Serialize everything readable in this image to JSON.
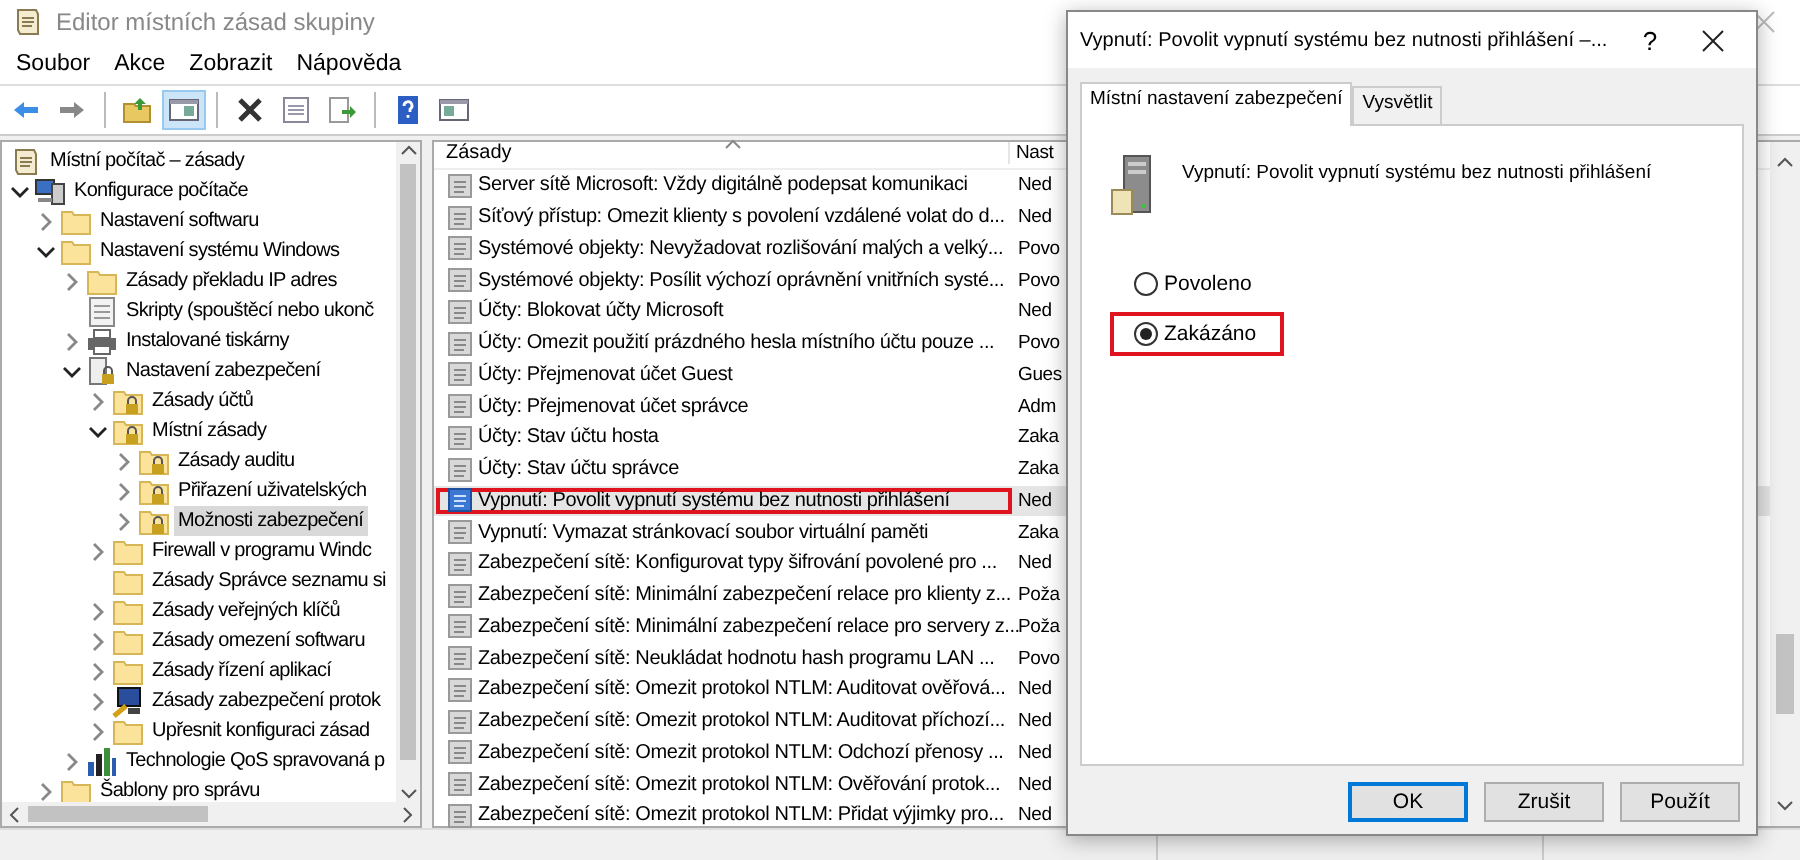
{
  "window": {
    "title": "Editor místních zásad skupiny"
  },
  "menu": [
    "Soubor",
    "Akce",
    "Zobrazit",
    "Nápověda"
  ],
  "toolbar": [
    {
      "buttons": [
        {
          "kind": "back",
          "pressed": false
        },
        {
          "kind": "forward",
          "pressed": false
        }
      ]
    },
    {
      "buttons": [
        {
          "kind": "up",
          "pressed": false
        },
        {
          "kind": "pane",
          "pressed": true
        }
      ]
    },
    {
      "buttons": [
        {
          "kind": "delete",
          "pressed": false
        },
        {
          "kind": "properties",
          "pressed": false
        },
        {
          "kind": "export",
          "pressed": false
        }
      ]
    },
    {
      "buttons": [
        {
          "kind": "help",
          "pressed": false
        },
        {
          "kind": "pane2",
          "pressed": false
        }
      ]
    }
  ],
  "tree": [
    {
      "label": "Místní počítač – zásady",
      "kind": "policy",
      "selected": false,
      "children": [
        {
          "label": "Konfigurace počítače",
          "kind": "computer",
          "expandable": true,
          "expanded": true,
          "selected": false,
          "children": [
            {
              "label": "Nastavení softwaru",
              "kind": "folder",
              "expandable": true,
              "expanded": false,
              "selected": false
            },
            {
              "label": "Nastavení systému Windows",
              "kind": "folder",
              "expandable": true,
              "expanded": true,
              "selected": false,
              "children": [
                {
                  "label": "Zásady překladu IP adres",
                  "kind": "folder",
                  "expandable": true,
                  "expanded": false,
                  "selected": false
                },
                {
                  "label": "Skripty (spouštěcí nebo ukonč",
                  "kind": "script",
                  "expandable": false,
                  "selected": false
                },
                {
                  "label": "Instalované tiskárny",
                  "kind": "printer",
                  "expandable": true,
                  "expanded": false,
                  "selected": false
                },
                {
                  "label": "Nastavení zabezpečení",
                  "kind": "secdoc",
                  "expandable": true,
                  "expanded": true,
                  "selected": false,
                  "children": [
                    {
                      "label": "Zásady účtů",
                      "kind": "lockfolder",
                      "expandable": true,
                      "expanded": false,
                      "selected": false
                    },
                    {
                      "label": "Místní zásady",
                      "kind": "lockfolder",
                      "expandable": true,
                      "expanded": true,
                      "selected": false,
                      "children": [
                        {
                          "label": "Zásady auditu",
                          "kind": "lockfolder",
                          "expandable": true,
                          "expanded": false,
                          "selected": false
                        },
                        {
                          "label": "Přiřazení uživatelských",
                          "kind": "lockfolder",
                          "expandable": true,
                          "expanded": false,
                          "selected": false
                        },
                        {
                          "label": "Možnosti zabezpečení",
                          "kind": "lockfolder",
                          "expandable": true,
                          "expanded": false,
                          "selected": true
                        }
                      ]
                    },
                    {
                      "label": "Firewall v programu Windc",
                      "kind": "folder",
                      "expandable": true,
                      "expanded": false,
                      "selected": false
                    },
                    {
                      "label": "Zásady Správce seznamu si",
                      "kind": "folder",
                      "expandable": false,
                      "selected": false
                    },
                    {
                      "label": "Zásady veřejných klíčů",
                      "kind": "folder",
                      "expandable": true,
                      "expanded": false,
                      "selected": false
                    },
                    {
                      "label": "Zásady omezení softwaru",
                      "kind": "folder",
                      "expandable": true,
                      "expanded": false,
                      "selected": false
                    },
                    {
                      "label": "Zásady řízení aplikací",
                      "kind": "folder",
                      "expandable": true,
                      "expanded": false,
                      "selected": false
                    },
                    {
                      "label": "Zásady zabezpečení protok",
                      "kind": "monitor",
                      "expandable": true,
                      "expanded": false,
                      "selected": false
                    },
                    {
                      "label": "Upřesnit konfiguraci zásad",
                      "kind": "folder",
                      "expandable": true,
                      "expanded": false,
                      "selected": false
                    }
                  ]
                },
                {
                  "label": "Technologie QoS spravovaná p",
                  "kind": "chart",
                  "expandable": true,
                  "expanded": false,
                  "selected": false
                }
              ]
            },
            {
              "label": "Šablony pro správu",
              "kind": "folder",
              "expandable": true,
              "expanded": false,
              "selected": false
            }
          ]
        }
      ]
    }
  ],
  "list": {
    "columns": [
      "Zásady",
      "Nast"
    ],
    "rows": [
      {
        "policy": "Server sítě Microsoft: Vždy digitálně podepsat komunikaci",
        "setting": "Ned",
        "selected": false,
        "highlighted": false
      },
      {
        "policy": "Síťový přístup: Omezit klienty s povolení vzdálené volat do d...",
        "setting": "Ned",
        "selected": false,
        "highlighted": false
      },
      {
        "policy": "Systémové objekty: Nevyžadovat rozlišování malých a velký...",
        "setting": "Povo",
        "selected": false,
        "highlighted": false
      },
      {
        "policy": "Systémové objekty: Posílit výchozí oprávnění vnitřních systé...",
        "setting": "Povo",
        "selected": false,
        "highlighted": false
      },
      {
        "policy": "Účty: Blokovat účty Microsoft",
        "setting": "Ned",
        "selected": false,
        "highlighted": false
      },
      {
        "policy": "Účty: Omezit použití prázdného hesla místního účtu pouze ...",
        "setting": "Povo",
        "selected": false,
        "highlighted": false
      },
      {
        "policy": "Účty: Přejmenovat účet Guest",
        "setting": "Gues",
        "selected": false,
        "highlighted": false
      },
      {
        "policy": "Účty: Přejmenovat účet správce",
        "setting": "Adm",
        "selected": false,
        "highlighted": false
      },
      {
        "policy": "Účty: Stav účtu hosta",
        "setting": "Zaka",
        "selected": false,
        "highlighted": false
      },
      {
        "policy": "Účty: Stav účtu správce",
        "setting": "Zaka",
        "selected": false,
        "highlighted": false
      },
      {
        "policy": "Vypnutí: Povolit vypnutí systému bez nutnosti přihlášení",
        "setting": "Ned",
        "selected": true,
        "highlighted": true
      },
      {
        "policy": "Vypnutí: Vymazat stránkovací soubor virtuální paměti",
        "setting": "Zaka",
        "selected": false,
        "highlighted": false
      },
      {
        "policy": "Zabezpečení sítě: Konfigurovat typy šifrování povolené pro ...",
        "setting": "Ned",
        "selected": false,
        "highlighted": false
      },
      {
        "policy": "Zabezpečení sítě: Minimální zabezpečení relace pro klienty z...",
        "setting": "Poža",
        "selected": false,
        "highlighted": false
      },
      {
        "policy": "Zabezpečení sítě: Minimální zabezpečení relace pro servery z...",
        "setting": "Poža",
        "selected": false,
        "highlighted": false
      },
      {
        "policy": "Zabezpečení sítě: Neukládat hodnotu hash programu LAN ...",
        "setting": "Povo",
        "selected": false,
        "highlighted": false
      },
      {
        "policy": "Zabezpečení sítě: Omezit protokol NTLM: Auditovat ověřová...",
        "setting": "Ned",
        "selected": false,
        "highlighted": false
      },
      {
        "policy": "Zabezpečení sítě: Omezit protokol NTLM: Auditovat příchozí...",
        "setting": "Ned",
        "selected": false,
        "highlighted": false
      },
      {
        "policy": "Zabezpečení sítě: Omezit protokol NTLM: Odchozí přenosy ...",
        "setting": "Ned",
        "selected": false,
        "highlighted": false
      },
      {
        "policy": "Zabezpečení sítě: Omezit protokol NTLM: Ověřování protok...",
        "setting": "Ned",
        "selected": false,
        "highlighted": false
      },
      {
        "policy": "Zabezpečení sítě: Omezit protokol NTLM: Přidat výjimky pro...",
        "setting": "Ned",
        "selected": false,
        "highlighted": false
      }
    ]
  },
  "dialog": {
    "title": "Vypnutí: Povolit vypnutí systému bez nutnosti přihlášení –...",
    "help": "?",
    "tabs": [
      {
        "label": "Místní nastavení zabezpečení",
        "selected": true
      },
      {
        "label": "Vysvětlit",
        "selected": false
      }
    ],
    "policy": "Vypnutí: Povolit vypnutí systému bez nutnosti přihlášení",
    "options": [
      {
        "label": "Povoleno",
        "selected": false,
        "highlighted": false
      },
      {
        "label": "Zakázáno",
        "selected": true,
        "highlighted": true
      }
    ],
    "buttons": [
      {
        "label": "OK",
        "default": true
      },
      {
        "label": "Zrušit",
        "default": false
      },
      {
        "label": "Použít",
        "default": false
      }
    ]
  }
}
